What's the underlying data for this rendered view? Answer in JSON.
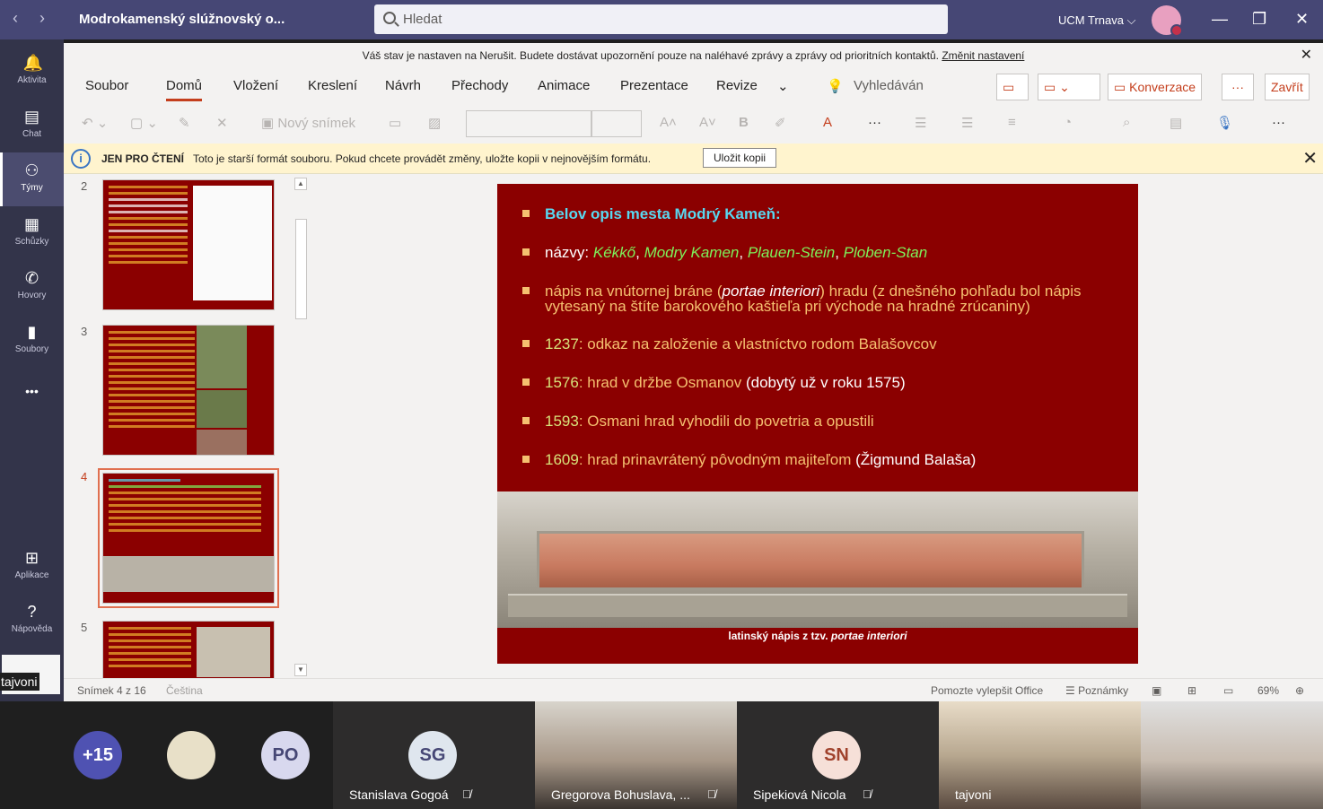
{
  "titlebar": {
    "title": "Modrokamenský slúžnovský o...",
    "search_placeholder": "Hledat",
    "org": "UCM Trnava ⌵",
    "back": "‹",
    "forward": "›",
    "minimize": "—",
    "maximize": "❐",
    "close": "✕"
  },
  "rail": {
    "items": [
      {
        "label": "Aktivita",
        "icon": "bell-icon",
        "glyph": "🔔"
      },
      {
        "label": "Chat",
        "icon": "chat-icon",
        "glyph": "▤"
      },
      {
        "label": "Týmy",
        "icon": "teams-icon",
        "glyph": "⚇"
      },
      {
        "label": "Schůzky",
        "icon": "calendar-icon",
        "glyph": "▦"
      },
      {
        "label": "Hovory",
        "icon": "phone-icon",
        "glyph": "✆"
      },
      {
        "label": "Soubory",
        "icon": "file-icon",
        "glyph": "▮"
      },
      {
        "label": "",
        "icon": "more-icon",
        "glyph": "•••"
      },
      {
        "label": "Aplikace",
        "icon": "apps-icon",
        "glyph": "⊞"
      },
      {
        "label": "Nápověda",
        "icon": "help-icon",
        "glyph": "?"
      }
    ],
    "self_name": "tajvoni"
  },
  "dnd_banner": {
    "text": "Váš stav je nastaven na Nerušit. Budete dostávat upozornění pouze na naléhavé zprávy a zprávy od prioritních kontaktů.",
    "link": "Změnit nastavení"
  },
  "ribbon": {
    "tabs": [
      "Soubor",
      "Domů",
      "Vložení",
      "Kreslení",
      "Návrh",
      "Přechody",
      "Animace",
      "Prezentace",
      "Revize"
    ],
    "active_tab": "Domů",
    "search": "Vyhledáván",
    "conversation": "Konverzace",
    "close": "Zavřít",
    "new_slide": "Nový snímek"
  },
  "readonly_bar": {
    "label": "JEN PRO ČTENÍ",
    "message": "Toto je starší formát souboru. Pokud chcete provádět změny, uložte kopii v nejnovějším formátu.",
    "button": "Uložit kopii"
  },
  "thumbnails": [
    {
      "number": "2"
    },
    {
      "number": "3"
    },
    {
      "number": "4",
      "active": true
    },
    {
      "number": "5"
    }
  ],
  "slide": {
    "title": "Belov opis mesta Modrý Kameň:",
    "names_label": "názvy: ",
    "names": [
      "Kékkő",
      "Modry Kamen",
      "Plauen-Stein",
      "Ploben-Stan"
    ],
    "inscription_a": "nápis na vnútornej bráne (",
    "inscription_i": "portae interiori",
    "inscription_b": ") hradu (z dnešného pohľadu bol nápis vytesaný na štíte barokového kaštieľa pri východe na hradné zrúcaniny)",
    "events": [
      {
        "year": "1237",
        "text": ": odkaz na založenie a vlastníctvo rodom Balašovcov",
        "extra": ""
      },
      {
        "year": "1576",
        "text": ": hrad v držbe Osmanov ",
        "extra": "(dobytý už v roku 1575)"
      },
      {
        "year": "1593",
        "text": ": Osmani hrad vyhodili do povetria a opustili",
        "extra": ""
      },
      {
        "year": "1609",
        "text": ": hrad prinavrátený pôvodným majiteľom ",
        "extra": "(Žigmund Balaša)"
      }
    ],
    "caption_a": "latinský nápis z tzv. ",
    "caption_i": "portae interiori"
  },
  "statusbar": {
    "slide_count": "Snímek 4 z 16",
    "language": "Čeština",
    "help_improve": "Pomozte vylepšit Office",
    "notes": "Poznámky",
    "zoom": "69%"
  },
  "participants": {
    "overflow": "+15",
    "po_initials": "PO",
    "sg_initials": "SG",
    "sg_name": "Stanislava Gogoá",
    "gb_name": "Gregorova Bohuslava, ...",
    "sn_initials": "SN",
    "sn_name": "Sipekiová Nicola",
    "tajvoni_name": "tajvoni"
  },
  "colors": {
    "titlebar": "#464775",
    "rail": "#33344a",
    "slide_bg": "#8b0000",
    "accent": "#c43e1c"
  }
}
